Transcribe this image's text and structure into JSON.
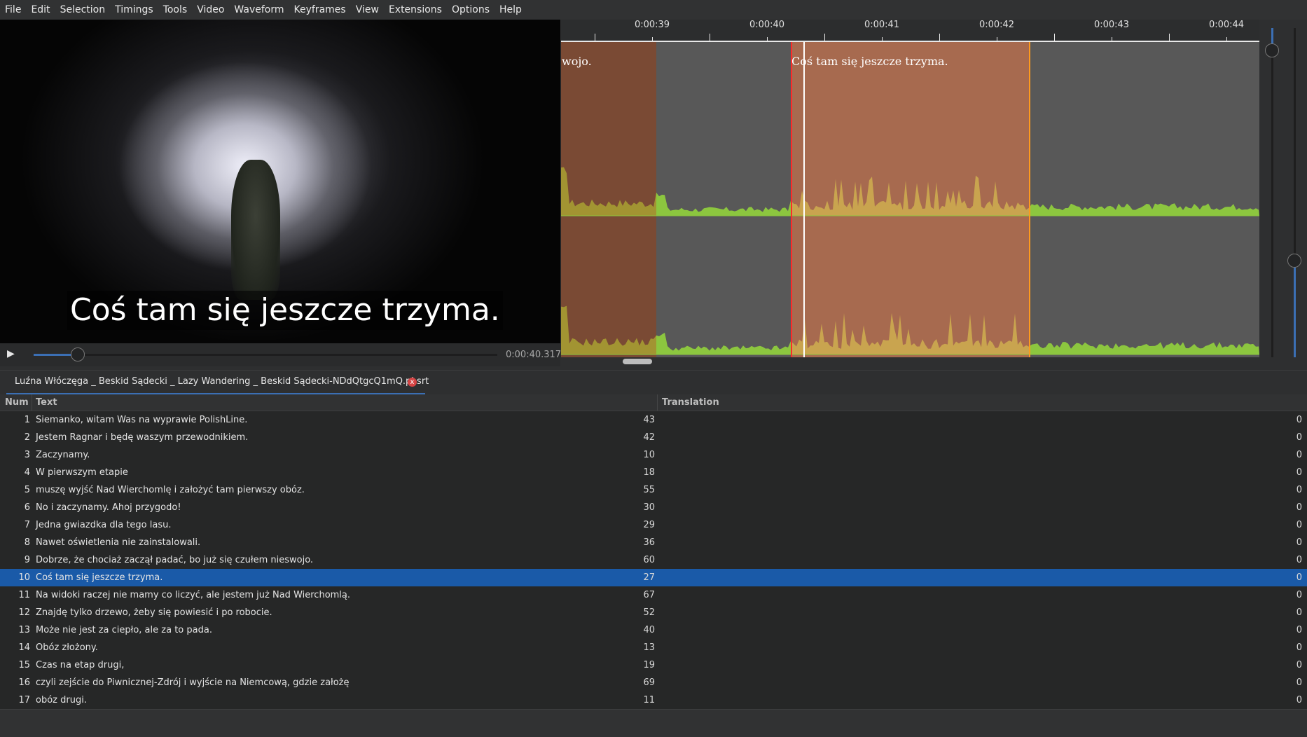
{
  "menu": [
    "File",
    "Edit",
    "Selection",
    "Timings",
    "Tools",
    "Video",
    "Waveform",
    "Keyframes",
    "View",
    "Extensions",
    "Options",
    "Help"
  ],
  "video": {
    "subtitle": "Coś tam się jeszcze trzyma.",
    "time": "0:00:40.317",
    "play_icon": "▶",
    "seek_progress": 0.09
  },
  "audio": {
    "ticks": [
      "0:00:39",
      "0:00:40",
      "0:00:41",
      "0:00:42",
      "0:00:43",
      "0:00:44"
    ],
    "prev_line_text": "wojo.",
    "current_line_text": "Coś tam się jeszcze trzyma."
  },
  "tab": {
    "filename": "Luźna Włóczęga _ Beskid Sądecki _ Lazy Wandering _ Beskid Sądecki-NDdQtgcQ1mQ.pl.srt",
    "close_icon": "x"
  },
  "grid": {
    "headers": {
      "num": "Num",
      "text": "Text",
      "translation": "Translation"
    },
    "selected_index": 9,
    "rows": [
      {
        "num": "1",
        "text": "Siemanko, witam Was na wyprawie PolishLine.",
        "count": "43",
        "trans": "0"
      },
      {
        "num": "2",
        "text": "Jestem Ragnar i będę waszym przewodnikiem.",
        "count": "42",
        "trans": "0"
      },
      {
        "num": "3",
        "text": "Zaczynamy.",
        "count": "10",
        "trans": "0"
      },
      {
        "num": "4",
        "text": "W pierwszym etapie",
        "count": "18",
        "trans": "0"
      },
      {
        "num": "5",
        "text": "muszę wyjść Nad Wierchomlę i założyć tam pierwszy obóz.",
        "count": "55",
        "trans": "0"
      },
      {
        "num": "6",
        "text": "No i zaczynamy. Ahoj przygodo!",
        "count": "30",
        "trans": "0"
      },
      {
        "num": "7",
        "text": "Jedna gwiazdka dla tego lasu.",
        "count": "29",
        "trans": "0"
      },
      {
        "num": "8",
        "text": "Nawet oświetlenia nie zainstalowali.",
        "count": "36",
        "trans": "0"
      },
      {
        "num": "9",
        "text": "Dobrze, że chociaż zaczął padać, bo już się czułem nieswojo.",
        "count": "60",
        "trans": "0"
      },
      {
        "num": "10",
        "text": "Coś tam się jeszcze trzyma.",
        "count": "27",
        "trans": "0"
      },
      {
        "num": "11",
        "text": "Na widoki raczej nie mamy co liczyć, ale jestem już Nad Wierchomlą.",
        "count": "67",
        "trans": "0"
      },
      {
        "num": "12",
        "text": "Znajdę tylko drzewo, żeby się powiesić i po robocie.",
        "count": "52",
        "trans": "0"
      },
      {
        "num": "13",
        "text": "Może nie jest za ciepło, ale za to pada.",
        "count": "40",
        "trans": "0"
      },
      {
        "num": "14",
        "text": "Obóz złożony.",
        "count": "13",
        "trans": "0"
      },
      {
        "num": "15",
        "text": "Czas na etap drugi,",
        "count": "19",
        "trans": "0"
      },
      {
        "num": "16",
        "text": "czyli zejście do Piwnicznej-Zdrój i wyjście na Niemcową, gdzie założę",
        "count": "69",
        "trans": "0"
      },
      {
        "num": "17",
        "text": "obóz drugi.",
        "count": "11",
        "trans": "0"
      }
    ]
  }
}
